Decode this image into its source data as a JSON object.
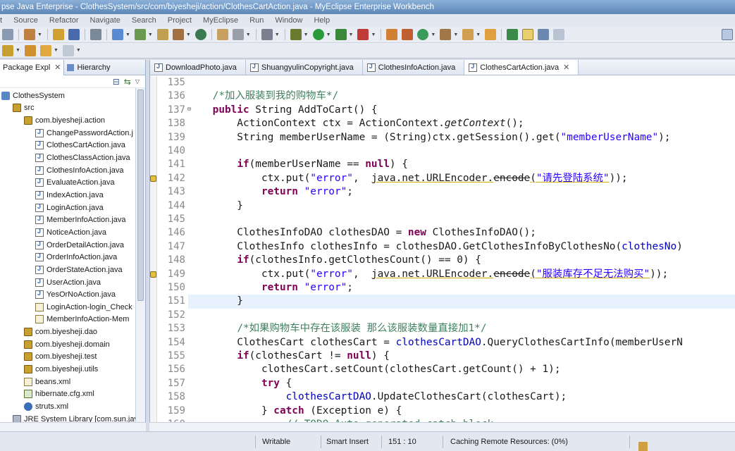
{
  "window": {
    "title": "pse Java Enterprise - ClothesSystem/src/com/biyesheji/action/ClothesCartAction.java - MyEclipse Enterprise Workbench"
  },
  "menu": [
    "t",
    "Source",
    "Refactor",
    "Navigate",
    "Search",
    "Project",
    "MyEclipse",
    "Run",
    "Window",
    "Help"
  ],
  "left_pane": {
    "tab_package": "Package Expl",
    "tab_hierarchy": "Hierarchy",
    "tree": [
      {
        "label": "ClothesSystem",
        "icon": "project-icon",
        "indent": 1
      },
      {
        "label": "src",
        "icon": "source-folder-icon",
        "indent": 2
      },
      {
        "label": "com.biyesheji.action",
        "icon": "package-icon",
        "indent": 3
      },
      {
        "label": "ChangePasswordAction.j",
        "icon": "java-file-icon",
        "indent": 4
      },
      {
        "label": "ClothesCartAction.java",
        "icon": "java-file-icon",
        "indent": 4
      },
      {
        "label": "ClothesClassAction.java",
        "icon": "java-file-icon",
        "indent": 4
      },
      {
        "label": "ClothesInfoAction.java",
        "icon": "java-file-icon",
        "indent": 4
      },
      {
        "label": "EvaluateAction.java",
        "icon": "java-file-icon",
        "indent": 4
      },
      {
        "label": "IndexAction.java",
        "icon": "java-file-icon",
        "indent": 4
      },
      {
        "label": "LoginAction.java",
        "icon": "java-file-icon",
        "indent": 4
      },
      {
        "label": "MemberInfoAction.java",
        "icon": "java-file-icon",
        "indent": 4
      },
      {
        "label": "NoticeAction.java",
        "icon": "java-file-icon",
        "indent": 4
      },
      {
        "label": "OrderDetailAction.java",
        "icon": "java-file-icon",
        "indent": 4
      },
      {
        "label": "OrderInfoAction.java",
        "icon": "java-file-icon",
        "indent": 4
      },
      {
        "label": "OrderStateAction.java",
        "icon": "java-file-icon",
        "indent": 4
      },
      {
        "label": "UserAction.java",
        "icon": "java-file-icon",
        "indent": 4
      },
      {
        "label": "YesOrNoAction.java",
        "icon": "java-file-icon",
        "indent": 4
      },
      {
        "label": "LoginAction-login_Check",
        "icon": "xml-file-icon",
        "indent": 4
      },
      {
        "label": "MemberInfoAction-Mem",
        "icon": "xml-file-icon",
        "indent": 4
      },
      {
        "label": "com.biyesheji.dao",
        "icon": "package-icon",
        "indent": 3
      },
      {
        "label": "com.biyesheji.domain",
        "icon": "package-icon",
        "indent": 3
      },
      {
        "label": "com.biyesheji.test",
        "icon": "package-icon",
        "indent": 3
      },
      {
        "label": "com.biyesheji.utils",
        "icon": "package-icon",
        "indent": 3
      },
      {
        "label": "beans.xml",
        "icon": "xml-file-icon",
        "indent": 3
      },
      {
        "label": "hibernate.cfg.xml",
        "icon": "config-file-icon",
        "indent": 3
      },
      {
        "label": "struts.xml",
        "icon": "gear-icon",
        "indent": 3
      },
      {
        "label": "JRE System Library [com.sun.jav",
        "icon": "library-icon",
        "indent": 2
      }
    ]
  },
  "editor": {
    "tabs": [
      {
        "label": "DownloadPhoto.java",
        "active": false
      },
      {
        "label": "ShuangyulinCopyright.java",
        "active": false
      },
      {
        "label": "ClothesInfoAction.java",
        "active": false
      },
      {
        "label": "ClothesCartAction.java",
        "active": true
      }
    ],
    "lines": [
      {
        "n": "135",
        "segs": []
      },
      {
        "n": "136",
        "segs": [
          {
            "t": "    "
          },
          {
            "t": "/*加入服装到我的购物车*/",
            "c": "cm"
          }
        ]
      },
      {
        "n": "137",
        "fold": "⊖",
        "segs": [
          {
            "t": "    "
          },
          {
            "t": "public",
            "c": "kw"
          },
          {
            "t": " String AddToCart() {"
          }
        ]
      },
      {
        "n": "138",
        "segs": [
          {
            "t": "        ActionContext ctx = ActionContext."
          },
          {
            "t": "getContext",
            "c": "it"
          },
          {
            "t": "();"
          }
        ]
      },
      {
        "n": "139",
        "segs": [
          {
            "t": "        String memberUserName = (String)ctx.getSession().get("
          },
          {
            "t": "\"memberUserName\"",
            "c": "str"
          },
          {
            "t": ");"
          }
        ]
      },
      {
        "n": "140",
        "segs": []
      },
      {
        "n": "141",
        "segs": [
          {
            "t": "        "
          },
          {
            "t": "if",
            "c": "kw"
          },
          {
            "t": "(memberUserName == "
          },
          {
            "t": "null",
            "c": "kw"
          },
          {
            "t": ") {"
          }
        ]
      },
      {
        "n": "142",
        "warn": true,
        "segs": [
          {
            "t": "            ctx.put("
          },
          {
            "t": "\"error\"",
            "c": "str"
          },
          {
            "t": ",  "
          },
          {
            "t": "java.net.URLEncoder.",
            "c": "uline"
          },
          {
            "t": "encode",
            "c": "uline strike"
          },
          {
            "t": "(",
            "c": "uline"
          },
          {
            "t": "\"请先登陆系统\"",
            "c": "str uline"
          },
          {
            "t": "));"
          }
        ]
      },
      {
        "n": "143",
        "segs": [
          {
            "t": "            "
          },
          {
            "t": "return",
            "c": "kw"
          },
          {
            "t": " "
          },
          {
            "t": "\"error\"",
            "c": "str"
          },
          {
            "t": ";"
          }
        ]
      },
      {
        "n": "144",
        "segs": [
          {
            "t": "        }"
          }
        ]
      },
      {
        "n": "145",
        "segs": []
      },
      {
        "n": "146",
        "segs": [
          {
            "t": "        ClothesInfoDAO clothesDAO = "
          },
          {
            "t": "new",
            "c": "kw"
          },
          {
            "t": " ClothesInfoDAO();"
          }
        ]
      },
      {
        "n": "147",
        "segs": [
          {
            "t": "        ClothesInfo clothesInfo = clothesDAO.GetClothesInfoByClothesNo("
          },
          {
            "t": "clothesNo",
            "c": "fld"
          },
          {
            "t": ")"
          }
        ]
      },
      {
        "n": "148",
        "segs": [
          {
            "t": "        "
          },
          {
            "t": "if",
            "c": "kw"
          },
          {
            "t": "(clothesInfo.getClothesCount() == 0) {"
          }
        ]
      },
      {
        "n": "149",
        "warn": true,
        "segs": [
          {
            "t": "            ctx.put("
          },
          {
            "t": "\"error\"",
            "c": "str"
          },
          {
            "t": ",  "
          },
          {
            "t": "java.net.URLEncoder.",
            "c": "uline"
          },
          {
            "t": "encode",
            "c": "uline strike"
          },
          {
            "t": "(",
            "c": "uline"
          },
          {
            "t": "\"服装库存不足无法购买\"",
            "c": "str uline"
          },
          {
            "t": "));"
          }
        ]
      },
      {
        "n": "150",
        "segs": [
          {
            "t": "            "
          },
          {
            "t": "return",
            "c": "kw"
          },
          {
            "t": " "
          },
          {
            "t": "\"error\"",
            "c": "str"
          },
          {
            "t": ";"
          }
        ]
      },
      {
        "n": "151",
        "hl": true,
        "segs": [
          {
            "t": "        }"
          }
        ]
      },
      {
        "n": "152",
        "segs": []
      },
      {
        "n": "153",
        "segs": [
          {
            "t": "        "
          },
          {
            "t": "/*如果购物车中存在该服装 那么该服装数量直接加1*/",
            "c": "cm"
          }
        ]
      },
      {
        "n": "154",
        "segs": [
          {
            "t": "        ClothesCart clothesCart = "
          },
          {
            "t": "clothesCartDAO",
            "c": "fld"
          },
          {
            "t": ".QueryClothesCartInfo(memberUserN"
          }
        ]
      },
      {
        "n": "155",
        "segs": [
          {
            "t": "        "
          },
          {
            "t": "if",
            "c": "kw"
          },
          {
            "t": "(clothesCart != "
          },
          {
            "t": "null",
            "c": "kw"
          },
          {
            "t": ") {"
          }
        ]
      },
      {
        "n": "156",
        "segs": [
          {
            "t": "            clothesCart.setCount(clothesCart.getCount() + 1);"
          }
        ]
      },
      {
        "n": "157",
        "segs": [
          {
            "t": "            "
          },
          {
            "t": "try",
            "c": "kw"
          },
          {
            "t": " {"
          }
        ]
      },
      {
        "n": "158",
        "segs": [
          {
            "t": "                "
          },
          {
            "t": "clothesCartDAO",
            "c": "fld"
          },
          {
            "t": ".UpdateClothesCart(clothesCart);"
          }
        ]
      },
      {
        "n": "159",
        "segs": [
          {
            "t": "            } "
          },
          {
            "t": "catch",
            "c": "kw"
          },
          {
            "t": " (Exception e) {"
          }
        ]
      },
      {
        "n": "160",
        "segs": [
          {
            "t": "                "
          },
          {
            "t": "// TODO Auto-generated catch block",
            "c": "cm"
          }
        ]
      }
    ]
  },
  "status": {
    "mode": "Writable",
    "insert": "Smart Insert",
    "position": "151 : 10",
    "task": "Caching Remote Resources: (0%)"
  }
}
